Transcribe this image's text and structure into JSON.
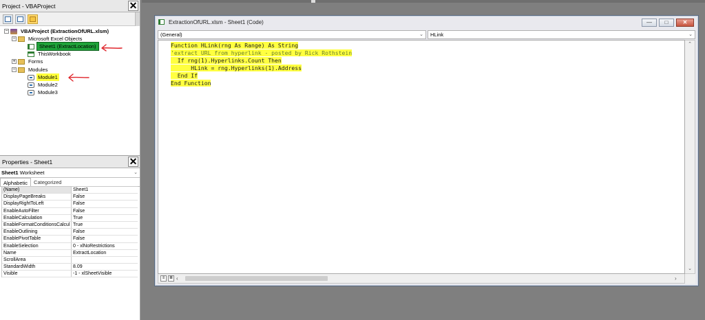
{
  "project_pane": {
    "title": "Project - VBAProject",
    "close_glyph": "✕",
    "tree": [
      {
        "id": "root",
        "expander": "−",
        "icon": "vbaproject-icon",
        "label": "VBAProject (ExtractionOfURL.xlsm)"
      },
      {
        "id": "excel-objects",
        "expander": "−",
        "icon": "folder-icon",
        "label": "Microsoft Excel Objects"
      },
      {
        "id": "sheet1",
        "icon": "worksheet-icon",
        "label": "Sheet1 (ExtractLocation)"
      },
      {
        "id": "thisworkbook",
        "icon": "workbook-icon",
        "label": "ThisWorkbook"
      },
      {
        "id": "forms",
        "expander": "+",
        "icon": "folder-icon",
        "label": "Forms"
      },
      {
        "id": "modules",
        "expander": "−",
        "icon": "folder-icon",
        "label": "Modules"
      },
      {
        "id": "module1",
        "icon": "module-icon",
        "label": "Module1"
      },
      {
        "id": "module2",
        "icon": "module-icon",
        "label": "Module2"
      },
      {
        "id": "module3",
        "icon": "module-icon",
        "label": "Module3"
      }
    ],
    "annotation_color": "#e0262c"
  },
  "properties_pane": {
    "title": "Properties - Sheet1",
    "close_glyph": "✕",
    "object_name": "Sheet1",
    "object_type": "Worksheet",
    "tabs": [
      "Alphabetic",
      "Categorized"
    ],
    "rows": [
      {
        "name": "(Name)",
        "value": "Sheet1"
      },
      {
        "name": "DisplayPageBreaks",
        "value": "False"
      },
      {
        "name": "DisplayRightToLeft",
        "value": "False"
      },
      {
        "name": "EnableAutoFilter",
        "value": "False"
      },
      {
        "name": "EnableCalculation",
        "value": "True"
      },
      {
        "name": "EnableFormatConditionsCalcul",
        "value": "True"
      },
      {
        "name": "EnableOutlining",
        "value": "False"
      },
      {
        "name": "EnablePivotTable",
        "value": "False"
      },
      {
        "name": "EnableSelection",
        "value": "0 - xlNoRestrictions"
      },
      {
        "name": "Name",
        "value": "ExtractLocation"
      },
      {
        "name": "ScrollArea",
        "value": ""
      },
      {
        "name": "StandardWidth",
        "value": "8.09"
      },
      {
        "name": "Visible",
        "value": "-1 - xlSheetVisible"
      }
    ]
  },
  "code_window": {
    "title": "ExtractionOfURL.xlsm - Sheet1 (Code)",
    "buttons": {
      "minimize": "—",
      "maximize": "□",
      "close": "✕"
    },
    "object_combo": "(General)",
    "procedure_combo": "HLink",
    "highlight_color": "#ffff40",
    "code_lines": [
      {
        "text": "Function HLink(rng As Range) As String",
        "indent": 0,
        "comment": false
      },
      {
        "text": "'extract URL from hyperlink - posted by Rick Rothstein",
        "indent": 0,
        "comment": true
      },
      {
        "text": "  If rng(1).Hyperlinks.Count Then",
        "indent": 1,
        "comment": false
      },
      {
        "text": "      HLink = rng.Hyperlinks(1).Address",
        "indent": 1,
        "comment": false
      },
      {
        "text": "  End If",
        "indent": 1,
        "comment": false
      },
      {
        "text": "End Function",
        "indent": 0,
        "comment": false
      }
    ]
  }
}
